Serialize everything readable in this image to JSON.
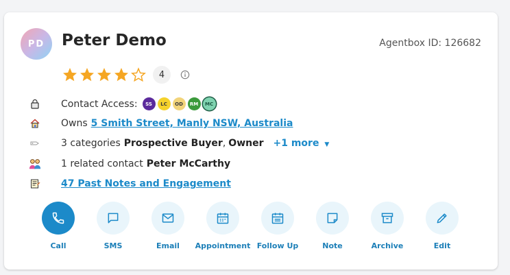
{
  "contact": {
    "initials": "PD",
    "name": "Peter Demo",
    "agentbox_id": "Agentbox ID: 126682",
    "rating": 4,
    "rating_label": "4"
  },
  "rows": {
    "access_label": "Contact Access:",
    "access_chips": [
      {
        "text": "SS",
        "bg": "#5b2a9c",
        "fg": "#ffffff"
      },
      {
        "text": "LC",
        "bg": "#f5d22b",
        "fg": "#3a3a3a"
      },
      {
        "text": "OD",
        "bg": "#f2d47a",
        "fg": "#3a3a3a"
      },
      {
        "text": "RM",
        "bg": "#3b9a3b",
        "fg": "#ffffff"
      },
      {
        "text": "MC",
        "bg": "#7fd3b0",
        "fg": "#1d5c45"
      }
    ],
    "owns_prefix": "Owns",
    "owns_link": "5 Smith Street, Manly NSW, Australia",
    "categories_prefix": "3 categories",
    "category_1": "Prospective Buyer",
    "category_sep": ",",
    "category_2": "Owner",
    "more_label": "+1 more",
    "related_prefix": "1 related contact",
    "related_name": "Peter McCarthy",
    "notes_link": "47 Past Notes and Engagement"
  },
  "actions": [
    {
      "label": "Call",
      "icon": "phone-icon"
    },
    {
      "label": "SMS",
      "icon": "chat-icon"
    },
    {
      "label": "Email",
      "icon": "mail-icon"
    },
    {
      "label": "Appointment",
      "icon": "calendar-icon"
    },
    {
      "label": "Follow Up",
      "icon": "calendar-list-icon"
    },
    {
      "label": "Note",
      "icon": "sticky-note-icon"
    },
    {
      "label": "Archive",
      "icon": "archive-icon"
    },
    {
      "label": "Edit",
      "icon": "pencil-icon"
    }
  ],
  "colors": {
    "accent": "#1c8ac9",
    "star": "#f5a623"
  }
}
